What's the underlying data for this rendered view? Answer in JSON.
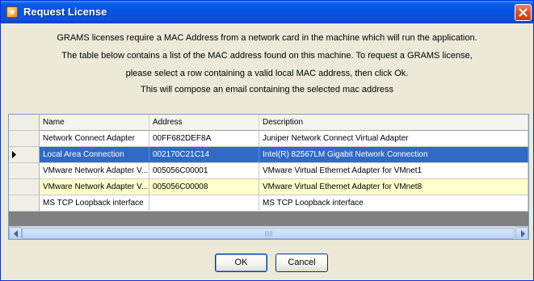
{
  "window": {
    "title": "Request License"
  },
  "message": {
    "line1": "GRAMS licenses require a MAC Address from a network card in the machine which will run the application.",
    "line2": "The table below contains a list of the MAC address found on this machine.  To request a GRAMS license,",
    "line3": "please select a row containing a valid local MAC address, then click Ok.",
    "line4": "This will compose an email containing the selected mac address"
  },
  "table": {
    "columns": [
      "Name",
      "Address",
      "Description"
    ],
    "rows": [
      {
        "name": "Network Connect Adapter",
        "address": "00FF682DEF8A",
        "description": "Juniper Network Connect Virtual Adapter",
        "state": "normal"
      },
      {
        "name": "Local Area Connection",
        "address": "002170C21C14",
        "description": "Intel(R) 82567LM Gigabit Network Connection",
        "state": "selected"
      },
      {
        "name": "VMware Network Adapter V...",
        "address": "005056C00001",
        "description": "VMware Virtual Ethernet Adapter for VMnet1",
        "state": "normal"
      },
      {
        "name": "VMware Network Adapter V...",
        "address": "005056C00008",
        "description": "VMware Virtual Ethernet Adapter for VMnet8",
        "state": "highlighted"
      },
      {
        "name": "MS TCP Loopback interface",
        "address": "",
        "description": "MS TCP Loopback interface",
        "state": "normal"
      }
    ],
    "row_indicator_icon": "current-row-arrow-icon"
  },
  "scrollbar": {
    "left_icon": "scroll-left-arrow-icon",
    "right_icon": "scroll-right-arrow-icon"
  },
  "buttons": {
    "ok": "OK",
    "cancel": "Cancel"
  },
  "colors": {
    "selected_row": "#316ac5",
    "highlighted_row": "#ffffcc",
    "title_bar": "#0a5de6",
    "dialog_bg": "#ece9d8"
  }
}
